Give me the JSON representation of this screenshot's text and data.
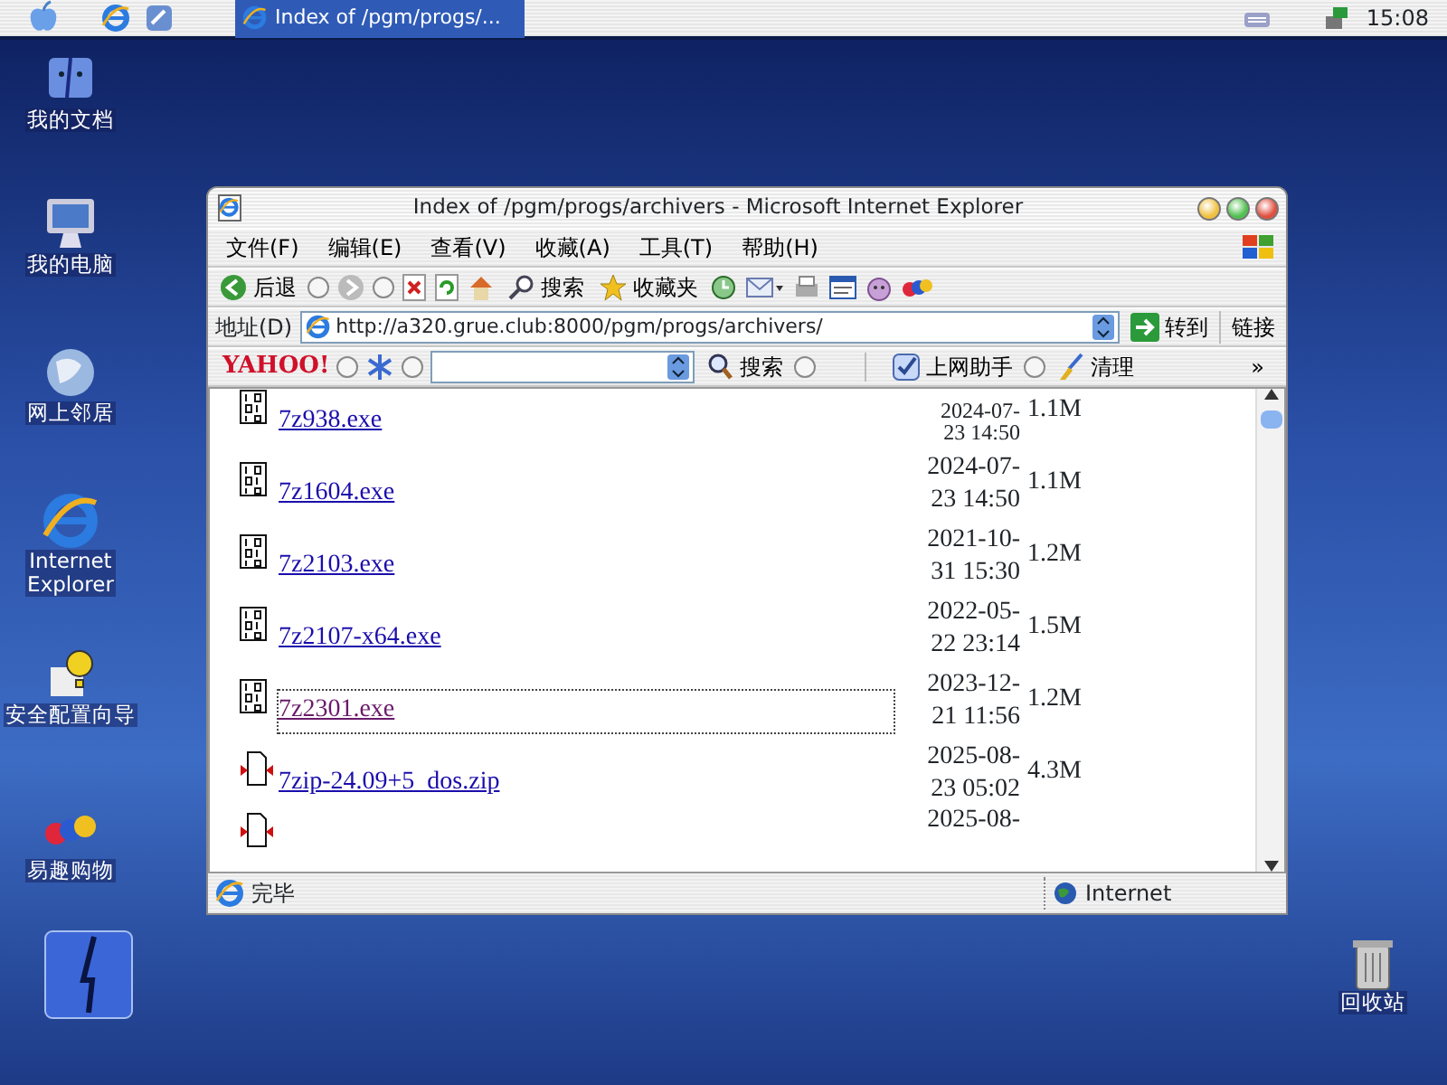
{
  "taskbar": {
    "apps": [
      {
        "title": "Index of /pgm/progs/...",
        "selected": true
      }
    ],
    "clock": "15:08"
  },
  "desktop_icons": [
    {
      "label": "我的文档",
      "kind": "docs"
    },
    {
      "label": "我的电脑",
      "kind": "computer"
    },
    {
      "label": "网上邻居",
      "kind": "globe"
    },
    {
      "label": "Internet Explorer",
      "kind": "ie"
    },
    {
      "label": "安全配置向导",
      "kind": "wizard"
    },
    {
      "label": "易趣购物",
      "kind": "ebay"
    }
  ],
  "recycle_bin": {
    "label": "回收站"
  },
  "window": {
    "title": "Index of /pgm/progs/archivers - Microsoft Internet Explorer",
    "menu": [
      "文件(F)",
      "编辑(E)",
      "查看(V)",
      "收藏(A)",
      "工具(T)",
      "帮助(H)"
    ],
    "toolbar": {
      "back": "后退",
      "search": "搜索",
      "favorites": "收藏夹"
    },
    "address": {
      "label": "地址(D)",
      "url": "http://a320.grue.club:8000/pgm/progs/archivers/",
      "go": "转到",
      "links": "链接"
    },
    "yahoo": {
      "logo": "YAHOO!",
      "search": "搜索",
      "helper": "上网助手",
      "clean": "清理",
      "more": "»"
    },
    "files": [
      {
        "kind": "exe",
        "name": "7z938.exe",
        "date": "2024-07-",
        "time": "23 14:50",
        "size": "1.1M",
        "visited": false
      },
      {
        "kind": "exe",
        "name": "7z1604.exe",
        "date": "2024-07-",
        "time": "23 14:50",
        "size": "1.1M",
        "visited": false
      },
      {
        "kind": "exe",
        "name": "7z2103.exe",
        "date": "2021-10-",
        "time": "31 15:30",
        "size": "1.2M",
        "visited": false
      },
      {
        "kind": "exe",
        "name": "7z2107-x64.exe",
        "date": "2022-05-",
        "time": "22 23:14",
        "size": "1.5M",
        "visited": false
      },
      {
        "kind": "exe",
        "name": "7z2301.exe",
        "date": "2023-12-",
        "time": "21 11:56",
        "size": "1.2M",
        "visited": true
      },
      {
        "kind": "zip",
        "name": "7zip-24.09+5_dos.zip",
        "date": "2025-08-",
        "time": "23 05:02",
        "size": "4.3M",
        "visited": false
      },
      {
        "kind": "zip",
        "date": "2025-08-"
      }
    ],
    "status": {
      "text": "完毕",
      "zone": "Internet"
    }
  }
}
